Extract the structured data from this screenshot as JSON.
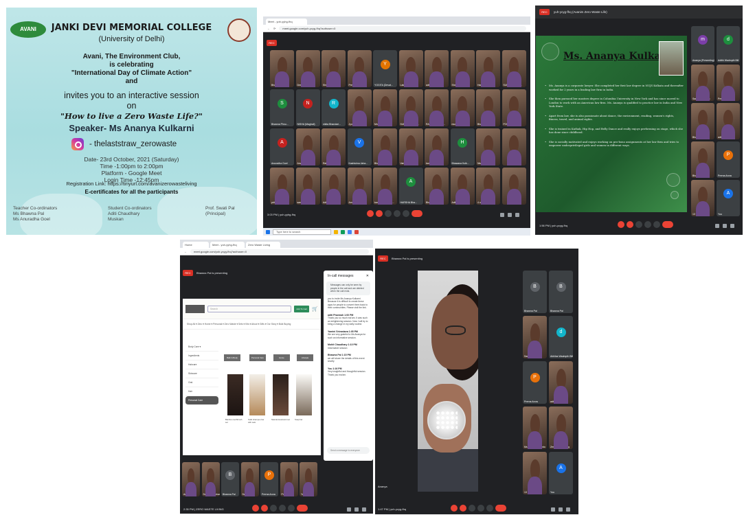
{
  "poster": {
    "logo_text": "AVANI",
    "college": "JANKI DEVI MEMORIAL COLLEGE",
    "university": "(University of Delhi)",
    "club_line1": "Avani, The Environment Club,",
    "club_line2": "is celebrating",
    "club_line3": "\"International Day of Climate Action\"",
    "club_line4": "and",
    "invite_line1": "invites you to an interactive session",
    "invite_line2": "on",
    "topic": "\"How to live a Zero Waste Life?\"",
    "speaker": "Speaker- Ms Ananya Kulkarni",
    "instagram": "- thelaststraw_zerowaste",
    "date": "Date- 23rd October, 2021 (Saturday)",
    "time": "Time -1:00pm to 2:00pm",
    "platform": "Platform - Google Meet",
    "login": "Login Time -12:45pm",
    "registration": "Registration Link: https://tinyurl.com/avanizerowasteliving",
    "ecert": "E-certificates for all the participants",
    "teacher_title": "Teacher Co-ordinators",
    "teacher_1": "Ms Bhawna Pal",
    "teacher_2": "Ms Anuradha Goel",
    "student_title": "Student Co-ordinators",
    "student_1": "Aditi Chaudhary",
    "student_2": "Muskan",
    "principal_name": "Prof. Swati Pal",
    "principal_title": "(Principal)"
  },
  "grid_meet": {
    "tab_label": "Meet - yuh-yyhg-fhq",
    "url": "meet.google.com/yuh-ycyg-fhq?authuser=0",
    "time": "3:03 PM | yuh-yyhg-fhq",
    "taskbar_search": "Type here to search",
    "participants": [
      {
        "name": "Bhawna Pal",
        "initial": "",
        "color": ""
      },
      {
        "name": "Deepanshi",
        "initial": "",
        "color": ""
      },
      {
        "name": "Shruti Pal",
        "initial": "",
        "color": ""
      },
      {
        "name": "Prerna Arora",
        "initial": "",
        "color": ""
      },
      {
        "name": "YOGITA (Devat...",
        "initial": "Y",
        "color": "#e37400"
      },
      {
        "name": "Lakshmi Pham...",
        "initial": "",
        "color": ""
      },
      {
        "name": "aditi Priyanka",
        "initial": "",
        "color": ""
      },
      {
        "name": "Shawna Pal",
        "initial": "",
        "color": ""
      },
      {
        "name": "Harsh Praca...",
        "initial": "",
        "color": ""
      },
      {
        "name": "SUIC Anju (IDN...",
        "initial": "",
        "color": ""
      },
      {
        "name": "Bhawna Phnu...",
        "initial": "S",
        "color": "#1e8e3e"
      },
      {
        "name": "NISHA (Maghali)",
        "initial": "N",
        "color": "#c5221f"
      },
      {
        "name": "nikita Bhandari...",
        "initial": "R",
        "color": "#12b5cb"
      },
      {
        "name": "Jyoti Sharma",
        "initial": "",
        "color": ""
      },
      {
        "name": "Mn Prerna Sh...",
        "initial": "",
        "color": ""
      },
      {
        "name": "SURBHI (St Ste...",
        "initial": "",
        "color": ""
      },
      {
        "name": "RAMESH (Yusu...",
        "initial": "",
        "color": ""
      },
      {
        "name": "mudam Phnu...",
        "initial": "",
        "color": ""
      },
      {
        "name": "Bhawna Pal",
        "initial": "",
        "color": ""
      },
      {
        "name": "POOJA (Devali...",
        "initial": "",
        "color": ""
      },
      {
        "name": "Anuradha Goel",
        "initial": "A",
        "color": "#c5221f"
      },
      {
        "name": "Anvit Bahman",
        "initial": "",
        "color": ""
      },
      {
        "name": "Ratna Pal",
        "initial": "",
        "color": ""
      },
      {
        "name": "Kashisima Jaha...",
        "initial": "V",
        "color": "#1a73e8"
      },
      {
        "name": "Bhawna",
        "initial": "",
        "color": ""
      },
      {
        "name": "Varsha Bansal",
        "initial": "",
        "color": ""
      },
      {
        "name": "kanika Kalidas",
        "initial": "",
        "color": ""
      },
      {
        "name": "Bhawana Kulk...",
        "initial": "H",
        "color": "#1e8e3e"
      },
      {
        "name": "Nishi Goyal",
        "initial": "",
        "color": ""
      },
      {
        "name": "",
        "initial": "",
        "color": ""
      },
      {
        "name": "pritiverma",
        "initial": "",
        "color": ""
      },
      {
        "name": "sanenji Prasoodil",
        "initial": "",
        "color": ""
      },
      {
        "name": "Aditi Chaudhary",
        "initial": "",
        "color": ""
      },
      {
        "name": "Amrita Bhan...",
        "initial": "",
        "color": ""
      },
      {
        "name": "kanika Prasoodil...",
        "initial": "",
        "color": ""
      },
      {
        "name": "HARSHA Bha...",
        "initial": "A",
        "color": "#1e8e3e"
      },
      {
        "name": "Bhawna Sharma",
        "initial": "",
        "color": ""
      },
      {
        "name": "Aditi Chaudhary",
        "initial": "",
        "color": ""
      },
      {
        "name": "4 others",
        "initial": "",
        "color": ""
      },
      {
        "name": "",
        "initial": "",
        "color": ""
      }
    ]
  },
  "slide_meet": {
    "title_bar": "yuh-ycyg-fhq (Avanim Zero Waste Life)",
    "time": "1:56 PM | yuh-ycyg-fhq",
    "slide_title": "Ms. Ananya Kulkarni",
    "bullets": [
      "Ms. Ananya is a corporate lawyer. She completed her first law degree in NUJS Kolkata and thereafter worked for 2 years in a leading law firm in India.",
      "She then pursued her masters degree in Columbia University in New York and has since moved to London to work with an American law firm. Ms. Ananya is qualified to practice law in India and New York State.",
      "Apart from law, she is also passionate about dance, the environment, reading, women's rights, fitness, travel, and animal rights.",
      "She is trained in Kathak, Hip Hop, and Belly Dance and really enjoys performing on stage, which she has done since childhood.",
      "She is socially motivated and enjoys working on pro-bono assignments at her law firm and tries to empower underprivileged girls and women in different ways."
    ],
    "side_participants": [
      {
        "name": "Ananya (Presenting)",
        "initial": "m",
        "color": "#7b3ea8"
      },
      {
        "name": "Adithi Wadmpth Bill",
        "initial": "d",
        "color": "#1e8e3e"
      },
      {
        "name": "Sandhya Mohan",
        "initial": "",
        "color": ""
      },
      {
        "name": "Prerna",
        "initial": "",
        "color": ""
      },
      {
        "name": "Bhawna Pal",
        "initial": "",
        "color": ""
      },
      {
        "name": "aditi Pharmah",
        "initial": "",
        "color": ""
      },
      {
        "name": "Bhawna Pal",
        "initial": "",
        "color": ""
      },
      {
        "name": "Prerna Arora",
        "initial": "P",
        "color": "#e8710a"
      },
      {
        "name": "13 others",
        "initial": "",
        "color": ""
      },
      {
        "name": "You",
        "initial": "A",
        "color": "#1a73e8"
      }
    ]
  },
  "share_meet": {
    "tab_1": "Home",
    "tab_2": "Meet - yuh-yyhg-fhq",
    "tab_3": "Zero Waste Living",
    "url": "meet.google.com/yuh-ycyg-fhq?authuser=0",
    "header": "Bhawna Pal is presenting",
    "shop_search": "Search",
    "shop_btn": "Add To Cart",
    "shop_nav": "Shop All ▾   Zero ▾   Home ▾   Personal ▾   Zero Waste ▾   Sets ▾   Kits ▾   About ▾   Gifts ▾   Our Story ▾   Bulk Buying",
    "sidebar": [
      "Body Care ▾",
      "Ingredients",
      "Haircare",
      "Skincare",
      "Oral",
      "Hair",
      "Personal Care"
    ],
    "categories": [
      "Bath & Body",
      "Personal Care",
      "Home",
      "Lifestyle"
    ],
    "products": [
      "Bamboo toothbrush set",
      "Solid shampoo bar with oats",
      "Natural deodorant set",
      "Soap bar"
    ],
    "chat_title": "In-call messages",
    "chat_notice": "Messages can only be seen by people in the call and are deleted when the call ends.",
    "messages": [
      {
        "author": "",
        "text": "you to invite Ms Ananya Kulkarni. Because it is difficult to create these apps for people to convert them back to their communities. Please visit the link."
      },
      {
        "author": "aditi Pharmah 1:00 PM",
        "text": "Thank you so much ma'am. It was such an enlightening session. Now I will try to bring a change in my daily routine."
      },
      {
        "author": "Yamini Srivastava 1:05 PM",
        "text": "We are very grateful to Ms Ananya for such an informative session."
      },
      {
        "author": "Mohit Chaudhary 1:10 PM",
        "text": "Informative session"
      },
      {
        "author": "Bhawna Pal 1:15 PM",
        "text": "we will share the details of this event shortly"
      },
      {
        "author": "You 1:16 PM",
        "text": "Very insightful and thoughtful session. Thank you ma'am."
      }
    ],
    "chat_input": "Send a message to everyone",
    "bottom_participants": [
      {
        "name": "Ananya",
        "initial": "",
        "color": ""
      },
      {
        "name": "Sandhya Mohan",
        "initial": "",
        "color": ""
      },
      {
        "name": "Bhawna Pal",
        "initial": "B",
        "color": "#5f6368"
      },
      {
        "name": "Swati Pal",
        "initial": "",
        "color": ""
      },
      {
        "name": "Prerna Arora",
        "initial": "P",
        "color": "#e8710a"
      },
      {
        "name": "Pra Bhan",
        "initial": "",
        "color": ""
      },
      {
        "name": "You",
        "initial": "",
        "color": ""
      }
    ],
    "time": "2:35 PM | ZERO WASTE LIVING"
  },
  "speaker_meet": {
    "title": "Bhawna Pal is presenting",
    "time": "1:47 PM | yuh-ycyg-fhq",
    "presenter_label": "Ananya",
    "side_participants": [
      {
        "name": "Bhawna Pal",
        "initial": "B",
        "color": "#5f6368"
      },
      {
        "name": "Bhawna Pal",
        "initial": "B",
        "color": "#5f6368"
      },
      {
        "name": "Sandhya Mohan",
        "initial": "",
        "color": ""
      },
      {
        "name": "Abhilas Wadmpth Bill",
        "initial": "d",
        "color": "#12b5cb"
      },
      {
        "name": "Prerna Arora",
        "initial": "P",
        "color": "#e8710a"
      },
      {
        "name": "aditi Pharmah",
        "initial": "",
        "color": ""
      },
      {
        "name": "Ms. Perunga Pandu",
        "initial": "",
        "color": ""
      },
      {
        "name": "Zero Waste Living",
        "initial": "",
        "color": ""
      },
      {
        "name": "13 others",
        "initial": "",
        "color": ""
      },
      {
        "name": "You",
        "initial": "A",
        "color": "#1a73e8"
      }
    ]
  }
}
